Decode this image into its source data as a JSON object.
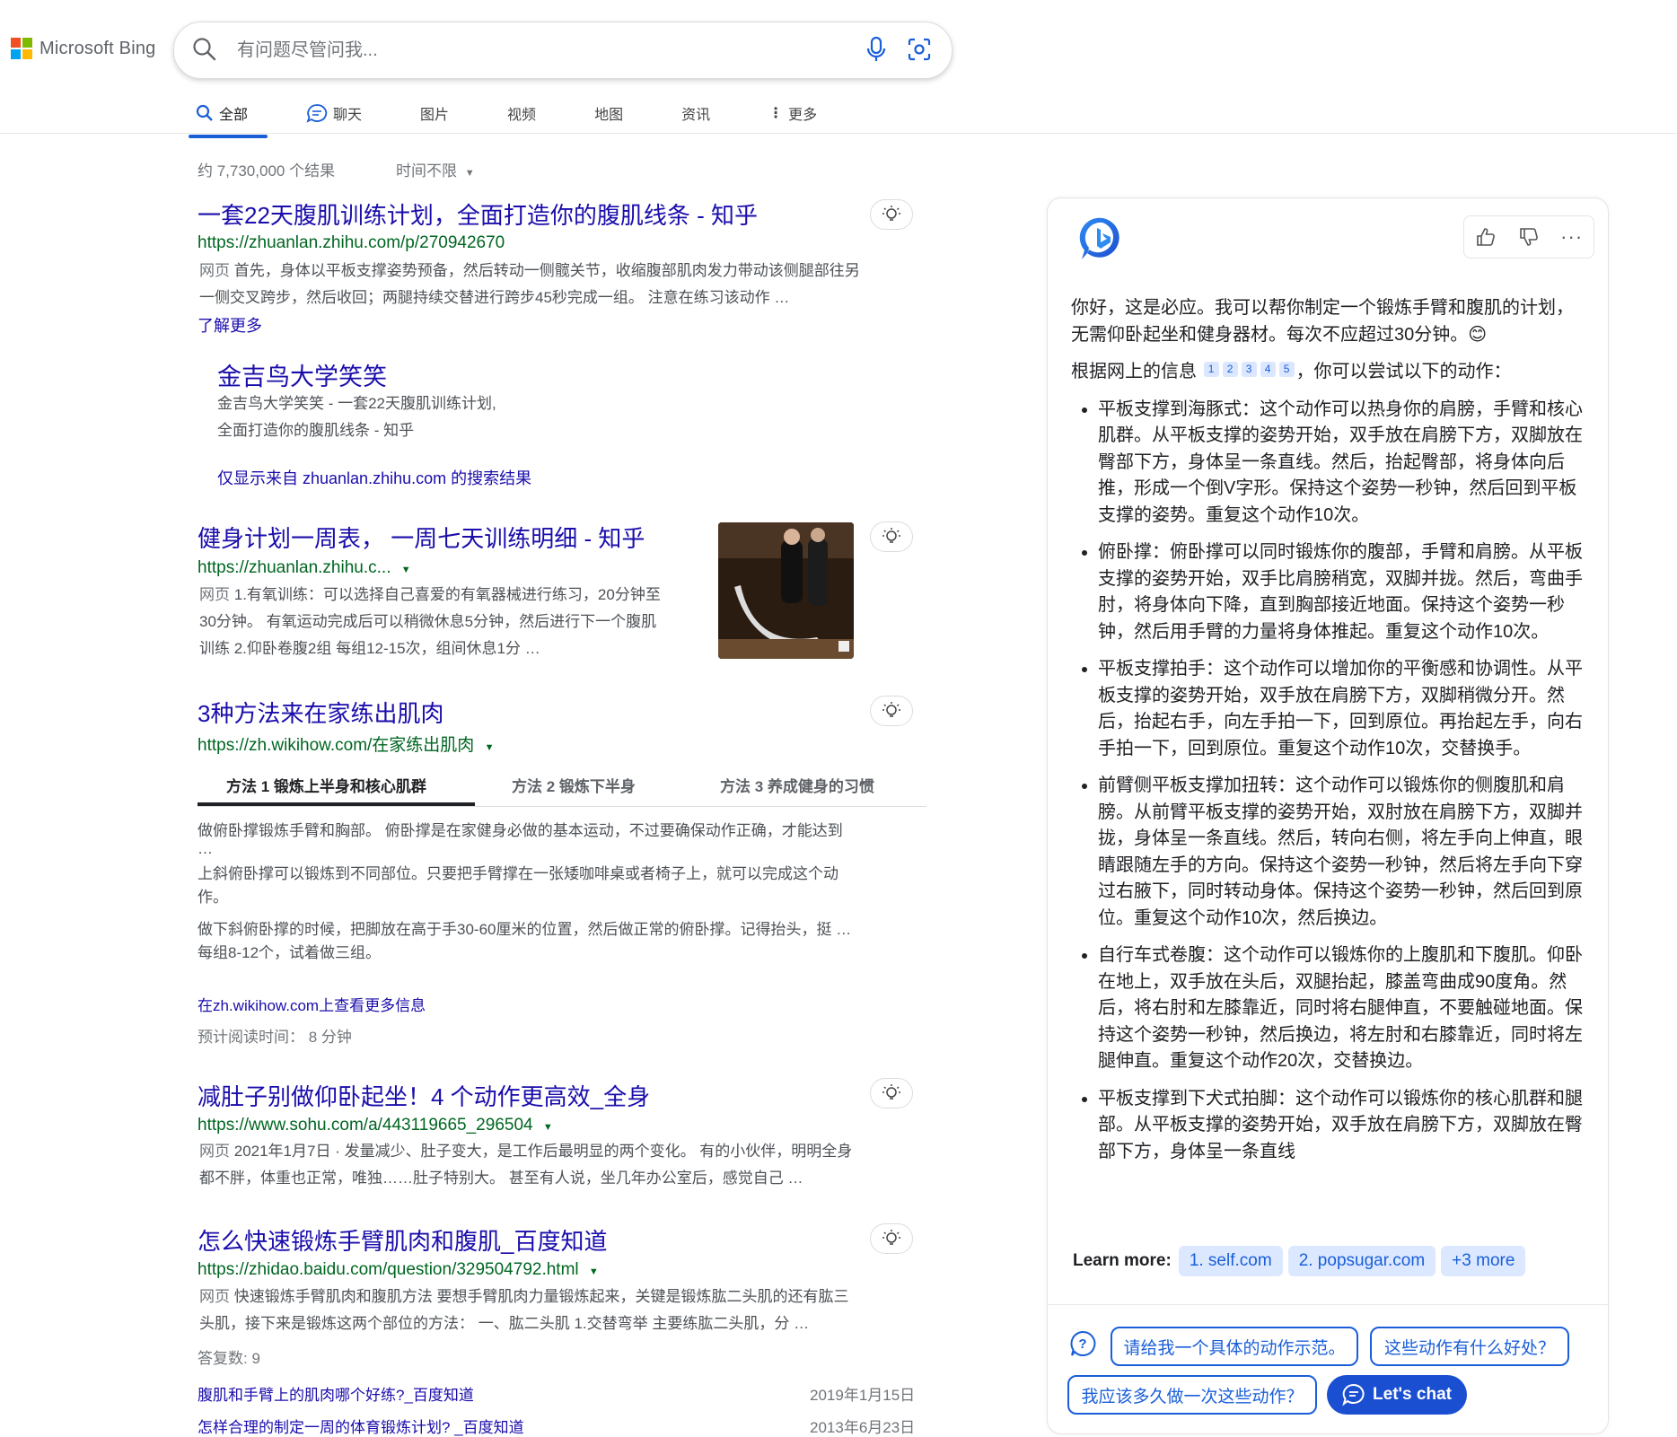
{
  "header": {
    "brand": "Microsoft Bing",
    "search_placeholder": "有问题尽管问我...",
    "tabs": [
      "全部",
      "聊天",
      "图片",
      "视频",
      "地图",
      "资讯",
      "更多"
    ],
    "logo_colors": [
      "#f25022",
      "#7fba00",
      "#00a4ef",
      "#ffb900"
    ]
  },
  "results_meta": {
    "count": "约 7,730,000 个结果",
    "time_filter": "时间不限"
  },
  "results": [
    {
      "title": "一套22天腹肌训练计划，全面打造你的腹肌线条 - 知乎",
      "url": "https://zhuanlan.zhihu.com/p/270942670",
      "label": "网页",
      "snippet1": "首先，身体以平板支撑姿势预备，然后转动一侧髋关节，收缩腹部肌肉发力带动该侧腿部往另",
      "snippet2": "一侧交叉跨步，然后收回；两腿持续交替进行跨步45秒完成一组。 注意在练习该动作 …",
      "more": "了解更多",
      "sub": {
        "title": "金吉鸟大学笑笑",
        "line1": "金吉鸟大学笑笑 - 一套22天腹肌训练计划,",
        "line2": "全面打造你的腹肌线条 - 知乎",
        "site_only": "仅显示来自 zhuanlan.zhihu.com 的搜索结果"
      }
    },
    {
      "title": "健身计划一周表， 一周七天训练明细 - 知乎",
      "url": "https://zhuanlan.zhihu.c...",
      "label": "网页",
      "snippet1": "1.有氧训练：可以选择自己喜爱的有氧器械进行练习，20分钟至",
      "snippet2": "30分钟。 有氧运动完成后可以稍微休息5分钟，然后进行下一个腹肌",
      "snippet3": "训练 2.仰卧卷腹2组 每组12-15次，组间休息1分 …"
    },
    {
      "title": "3种方法来在家练出肌肉",
      "url": "https://zh.wikihow.com/在家练出肌肉",
      "method_tabs": [
        "方法 1 锻炼上半身和核心肌群",
        "方法 2 锻炼下半身",
        "方法 3 养成健身的习惯"
      ],
      "items": [
        "做俯卧撑锻炼手臂和胸部。 俯卧撑是在家健身必做的基本运动，不过要确保动作正确，才能达到",
        "…",
        "上斜俯卧撑可以锻炼到不同部位。只要把手臂撑在一张矮咖啡桌或者椅子上，就可以完成这个动",
        "作。",
        "做下斜俯卧撑的时候，把脚放在高于手30-60厘米的位置，然后做正常的俯卧撑。记得抬头，挺 …",
        "每组8-12个，试着做三组。"
      ],
      "more": "在zh.wikihow.com上查看更多信息",
      "read_time": "预计阅读时间： 8 分钟"
    },
    {
      "title": "减肚子别做仰卧起坐！4 个动作更高效_全身",
      "url": "https://www.sohu.com/a/443119665_296504",
      "label": "网页",
      "snippet1": "2021年1月7日 · 发量减少、肚子变大，是工作后最明显的两个变化。 有的小伙伴，明明全身",
      "snippet2": "都不胖，体重也正常，唯独……肚子特别大。 甚至有人说，坐几年办公室后，感觉自己 …"
    },
    {
      "title": "怎么快速锻炼手臂肌肉和腹肌_百度知道",
      "url": "https://zhidao.baidu.com/question/329504792.html",
      "label": "网页",
      "snippet1": "快速锻炼手臂肌肉和腹肌方法 要想手臂肌肉力量锻炼起来，关键是锻炼肱二头肌的还有肱三",
      "snippet2": "头肌，接下来是锻炼这两个部位的方法： 一、肱二头肌 1.交替弯举 主要练肱二头肌，分 …",
      "answers": "答复数: 9",
      "related": [
        {
          "q": "腹肌和手臂上的肌肉哪个好练?_百度知道",
          "date": "2019年1月15日"
        },
        {
          "q": "怎样合理的制定一周的体育锻炼计划? _百度知道",
          "date": "2013年6月23日"
        }
      ]
    }
  ],
  "chat": {
    "intro": "你好，这是必应。我可以帮你制定一个锻炼手臂和腹肌的计划，无需仰卧起坐和健身器材。每次不应超过30分钟。",
    "emoji": "😊",
    "sources_prefix": "根据网上的信息",
    "cites": [
      "1",
      "2",
      "3",
      "4",
      "5"
    ],
    "sources_suffix": "，你可以尝试以下的动作：",
    "bullets": [
      "平板支撑到海豚式：这个动作可以热身你的肩膀，手臂和核心肌群。从平板支撑的姿势开始，双手放在肩膀下方，双脚放在臀部下方，身体呈一条直线。然后，抬起臀部，将身体向后推，形成一个倒V字形。保持这个姿势一秒钟，然后回到平板支撑的姿势。重复这个动作10次。",
      "俯卧撑：俯卧撑可以同时锻炼你的腹部，手臂和肩膀。从平板支撑的姿势开始，双手比肩膀稍宽，双脚并拢。然后，弯曲手肘，将身体向下降，直到胸部接近地面。保持这个姿势一秒钟，然后用手臂的力量将身体推起。重复这个动作10次。",
      "平板支撑拍手：这个动作可以增加你的平衡感和协调性。从平板支撑的姿势开始，双手放在肩膀下方，双脚稍微分开。然后，抬起右手，向左手拍一下，回到原位。再抬起左手，向右手拍一下，回到原位。重复这个动作10次，交替换手。",
      "前臂侧平板支撑加扭转：这个动作可以锻炼你的侧腹肌和肩膀。从前臂平板支撑的姿势开始，双肘放在肩膀下方，双脚并拢，身体呈一条直线。然后，转向右侧，将左手向上伸直，眼睛跟随左手的方向。保持这个姿势一秒钟，然后将左手向下穿过右腋下，同时转动身体。保持这个姿势一秒钟，然后回到原位。重复这个动作10次，然后换边。",
      "自行车式卷腹：这个动作可以锻炼你的上腹肌和下腹肌。仰卧在地上，双手放在头后，双腿抬起，膝盖弯曲成90度角。然后，将右肘和左膝靠近，同时将右腿伸直，不要触碰地面。保持这个姿势一秒钟，然后换边，将左肘和右膝靠近，同时将左腿伸直。重复这个动作20次，交替换边。",
      "平板支撑到下犬式拍脚：这个动作可以锻炼你的核心肌群和腿部。从平板支撑的姿势开始，双手放在肩膀下方，双脚放在臀部下方，身体呈一条直线"
    ],
    "learn_more": "Learn more:",
    "learn_links": [
      "1. self.com",
      "2. popsugar.com",
      "+3 more"
    ],
    "suggestions": [
      "请给我一个具体的动作示范。",
      "这些动作有什么好处？",
      "我应该多久做一次这些动作？"
    ],
    "chat_button": "Let's chat"
  }
}
